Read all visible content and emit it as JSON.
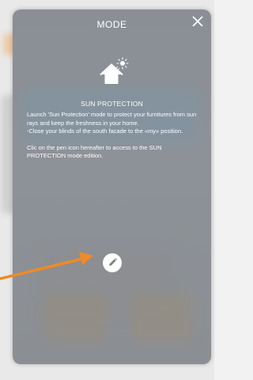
{
  "modal": {
    "title": "MODE",
    "close_icon": "close-icon",
    "section_title": "SUN PROTECTION",
    "description_line1": "Launch 'Sun Protection' mode to protect your furnitures from sun rays and keep the freshness in your home.",
    "description_line2": "-Close your blinds of the south facade to the «my» position.",
    "description_line3": "Clic on the pen icon hereafter to access to the SUN PROTECTION mode edition.",
    "icon": "house-sun-icon",
    "edit_icon": "pen-icon"
  },
  "annotation": {
    "arrow_icon": "arrow-icon",
    "arrow_color": "#f08a24"
  },
  "colors": {
    "modal_bg": "#8a8f95",
    "text": "#ffffff"
  }
}
